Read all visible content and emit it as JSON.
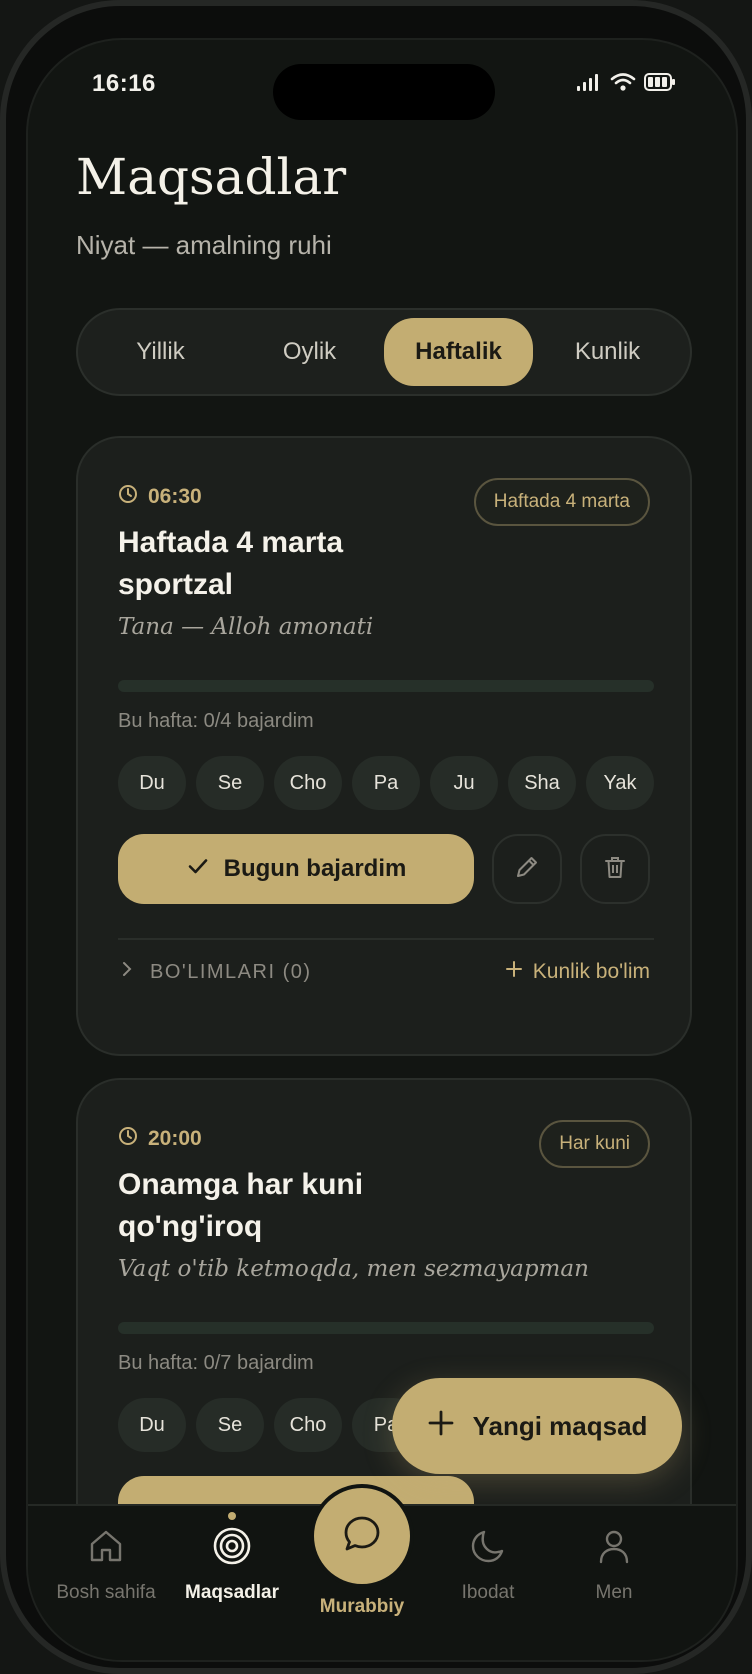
{
  "status": {
    "time": "16:16"
  },
  "header": {
    "title": "Maqsadlar",
    "subtitle": "Niyat — amalning ruhi"
  },
  "tabs": [
    {
      "label": "Yillik",
      "active": false
    },
    {
      "label": "Oylik",
      "active": false
    },
    {
      "label": "Haftalik",
      "active": true
    },
    {
      "label": "Kunlik",
      "active": false
    }
  ],
  "goals": [
    {
      "time": "06:30",
      "frequency": "Haftada 4 marta",
      "title": "Haftada 4 marta sportzal",
      "quote": "Tana — Alloh amonati",
      "progress": 0,
      "week_text": "Bu hafta: 0/4 bajardim",
      "days": [
        "Du",
        "Se",
        "Cho",
        "Pa",
        "Ju",
        "Sha",
        "Yak"
      ],
      "done_label": "Bugun bajardim",
      "sections_label": "BO'LIMLARI (0)",
      "add_section_label": "Kunlik bo'lim"
    },
    {
      "time": "20:00",
      "frequency": "Har kuni",
      "title": "Onamga har kuni qo'ng'iroq",
      "quote": "Vaqt o'tib ketmoqda, men sezmayapman",
      "progress": 0,
      "week_text": "Bu hafta: 0/7 bajardim",
      "days": [
        "Du",
        "Se",
        "Cho",
        "Pa"
      ]
    }
  ],
  "fab": {
    "label": "Yangi maqsad"
  },
  "nav": {
    "home": "Bosh sahifa",
    "goals": "Maqsadlar",
    "coach": "Murabbiy",
    "worship": "Ibodat",
    "profile": "Men"
  },
  "colors": {
    "accent": "#c3ad72",
    "background": "#121512",
    "card": "#1c1f1c"
  }
}
